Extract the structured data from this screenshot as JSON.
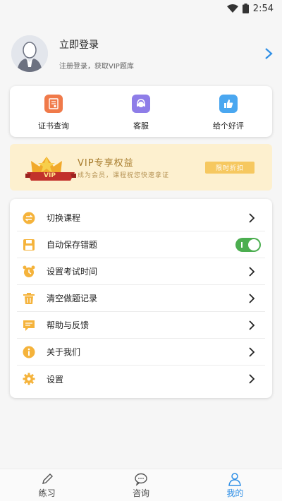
{
  "status_bar": {
    "time": "2:54",
    "icons": [
      "wifi-icon",
      "battery-icon"
    ]
  },
  "profile": {
    "title": "立即登录",
    "subtitle": "注册登录，获取VIP题库"
  },
  "quick_actions": [
    {
      "label": "证书查询",
      "icon": "certificate-icon",
      "color": "#f07a4a"
    },
    {
      "label": "客服",
      "icon": "customer-service-icon",
      "color": "#8e7de8"
    },
    {
      "label": "给个好评",
      "icon": "thumbs-up-icon",
      "color": "#4aa7f0"
    }
  ],
  "vip_banner": {
    "badge": "VIP",
    "title": "VIP专享权益",
    "subtitle": "成为会员，课程祝您快速拿证",
    "button": "限时折扣"
  },
  "menu": [
    {
      "label": "切换课程",
      "icon": "switch-icon",
      "type": "link"
    },
    {
      "label": "自动保存错题",
      "icon": "save-icon",
      "type": "toggle",
      "on": true
    },
    {
      "label": "设置考试时间",
      "icon": "alarm-clock-icon",
      "type": "link"
    },
    {
      "label": "清空做题记录",
      "icon": "trash-icon",
      "type": "link"
    },
    {
      "label": "帮助与反馈",
      "icon": "feedback-icon",
      "type": "link"
    },
    {
      "label": "关于我们",
      "icon": "info-icon",
      "type": "link"
    },
    {
      "label": "设置",
      "icon": "gear-icon",
      "type": "link"
    }
  ],
  "tabbar": [
    {
      "label": "练习",
      "icon": "pencil-icon",
      "active": false
    },
    {
      "label": "咨询",
      "icon": "chat-icon",
      "active": false
    },
    {
      "label": "我的",
      "icon": "user-icon",
      "active": true
    }
  ],
  "colors": {
    "accent": "#2f8fe6",
    "menu_icon": "#f5b33b",
    "toggle_on": "#4cae50",
    "vip_bg": "#fdf0cf"
  }
}
